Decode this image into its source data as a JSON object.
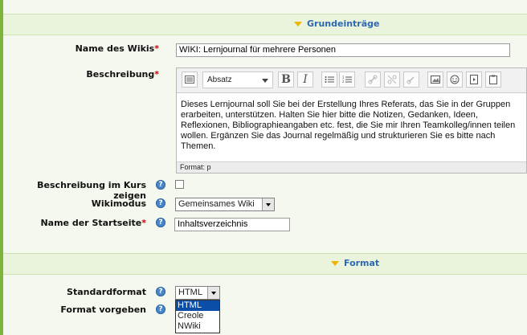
{
  "sections": {
    "general": "Grundeinträge",
    "format": "Format"
  },
  "fields": {
    "name_label": "Name des Wikis",
    "name_value": "WIKI: Lernjournal für mehrere Personen",
    "description_label": "Beschreibung",
    "show_description_label": "Beschreibung im Kurs zeigen",
    "wikimode_label": "Wikimodus",
    "wikimode_value": "Gemeinsames Wiki",
    "startpage_label": "Name der Startseite",
    "startpage_value": "Inhaltsverzeichnis",
    "standardformat_label": "Standardformat",
    "standardformat_value": "HTML",
    "forceformat_label": "Format vorgeben",
    "required_mark": "*",
    "help_glyph": "?"
  },
  "editor": {
    "paragraph_select": "Absatz",
    "content": "Dieses Lernjournal soll Sie bei der Erstellung Ihres Referats, das Sie in der Gruppen erarbeiten, unterstützen. Halten Sie hier bitte die Notizen, Gedanken, Ideen, Reflexionen, Bibliographieangaben etc. fest, die Sie mir Ihren Teamkolleg/innen teilen wollen. Ergänzen Sie das Journal regelmäßig und strukturieren Sie es bitte nach Themen.",
    "status": "Format: p",
    "toolbar_icons": [
      "toggle-toolbar-icon",
      "bold-icon",
      "italic-icon",
      "bullet-list-icon",
      "numbered-list-icon",
      "link-icon",
      "unlink-icon",
      "anchor-icon",
      "image-icon",
      "emoticon-icon",
      "media-icon",
      "paste-icon"
    ]
  },
  "format_options": [
    "HTML",
    "Creole",
    "NWiki"
  ],
  "colors": {
    "accent_green": "#7db43c",
    "header_blue": "#2d68b2",
    "required_red": "#d40000",
    "selection_blue": "#0a4ea8"
  }
}
